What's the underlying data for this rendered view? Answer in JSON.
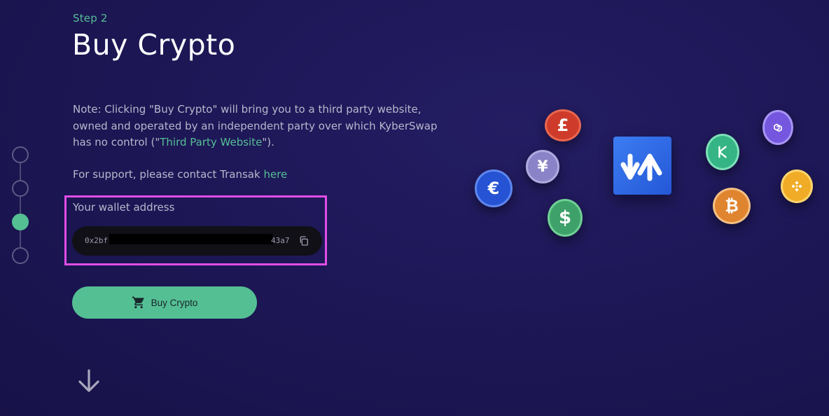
{
  "stepper": {
    "steps": [
      {
        "state": "inactive"
      },
      {
        "state": "inactive"
      },
      {
        "state": "active"
      },
      {
        "state": "inactive"
      }
    ]
  },
  "header": {
    "step_label": "Step 2",
    "title": "Buy Crypto"
  },
  "note": {
    "text_before": "Note: Clicking \"Buy Crypto\" will bring you to a third party website, owned and operated by an independent party over which KyberSwap has no control (\"",
    "link_label": "Third Party Website",
    "text_after": "\")."
  },
  "support": {
    "text": "For support, please contact Transak ",
    "link_label": "here"
  },
  "wallet": {
    "label": "Your wallet address",
    "prefix": "0x2bf",
    "suffix": "43a7"
  },
  "buy_button": {
    "label": "Buy Crypto"
  },
  "illustration": {
    "coins": [
      {
        "name": "pound-coin-icon",
        "symbol": "£",
        "color": "#d0402c"
      },
      {
        "name": "yen-coin-icon",
        "symbol": "¥",
        "color": "#8e86c8"
      },
      {
        "name": "euro-coin-icon",
        "symbol": "€",
        "color": "#2a55d8"
      },
      {
        "name": "dollar-coin-icon",
        "symbol": "$",
        "color": "#3fa56b"
      },
      {
        "name": "kyber-coin-icon",
        "symbol": "",
        "color": "#35b486"
      },
      {
        "name": "polygon-coin-icon",
        "symbol": "",
        "color": "#7b5fe0"
      },
      {
        "name": "bitcoin-coin-icon",
        "symbol": "₿",
        "color": "#e48a33"
      },
      {
        "name": "bnb-coin-icon",
        "symbol": "",
        "color": "#f1b12e"
      }
    ],
    "logo_color": "#2f6fe6"
  }
}
